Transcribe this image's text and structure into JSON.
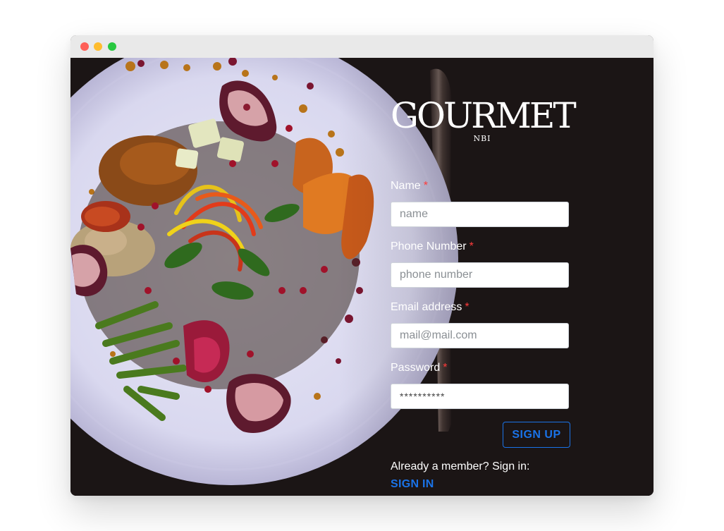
{
  "logo": {
    "main": "GOURMET",
    "sub": "NBI"
  },
  "form": {
    "fields": [
      {
        "label": "Name",
        "required_mark": "*",
        "placeholder": "name",
        "value": ""
      },
      {
        "label": "Phone Number",
        "required_mark": "*",
        "placeholder": "phone number",
        "value": ""
      },
      {
        "label": "Email address",
        "required_mark": "*",
        "placeholder": "mail@mail.com",
        "value": ""
      },
      {
        "label": "Password",
        "required_mark": "*",
        "placeholder": "",
        "value": "**********"
      }
    ],
    "signup_label": "SIGN UP",
    "member_text": "Already a member? Sign in:",
    "signin_label": "SIGN IN"
  },
  "colors": {
    "accent": "#1a73e8",
    "required": "#ff3b3b",
    "background": "#1b1515",
    "window_chrome": "#e9e9e9"
  },
  "icons": {
    "close": "close-dot",
    "minimize": "minimize-dot",
    "maximize": "maximize-dot"
  }
}
